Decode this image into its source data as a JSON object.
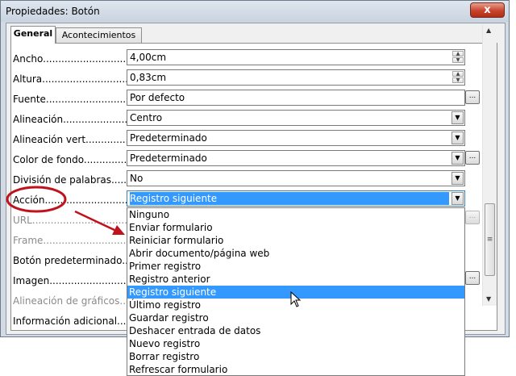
{
  "window": {
    "title": "Propiedades: Botón",
    "close": "x"
  },
  "tabs": [
    {
      "label": "General"
    },
    {
      "label": "Acontecimientos"
    }
  ],
  "fields": {
    "ancho": {
      "label": "Ancho.....................................",
      "value": "4,00cm"
    },
    "altura": {
      "label": "Altura.....................................",
      "value": "0,83cm"
    },
    "fuente": {
      "label": "Fuente....................................",
      "value": "Por defecto"
    },
    "alineacion": {
      "label": "Alineación................................",
      "value": "Centro"
    },
    "alineacion_vert": {
      "label": "Alineación vert.........................",
      "value": "Predeterminado"
    },
    "color_fondo": {
      "label": "Color de fondo..........................",
      "value": "Predeterminado"
    },
    "division": {
      "label": "División de palabras...............",
      "value": "No"
    },
    "accion": {
      "label": "Acción.....................................",
      "value": "Registro siguiente"
    },
    "url": {
      "label": "URL..........................................."
    },
    "frame": {
      "label": "Frame........................................"
    },
    "boton_pred": {
      "label": "Botón predeterminado................"
    },
    "imagen": {
      "label": "Imagen......................................"
    },
    "alin_graficos": {
      "label": "Alineación de gráficos..............."
    },
    "info_adicional": {
      "label": "Información adicional................"
    }
  },
  "buttons": {
    "dots": "..."
  },
  "dropdown_options": [
    "Ninguno",
    "Enviar formulario",
    "Reiniciar formulario",
    "Abrir documento/página web",
    "Primer registro",
    "Registro anterior",
    "Registro siguiente",
    "Último registro",
    "Guardar registro",
    "Deshacer entrada de datos",
    "Nuevo registro",
    "Borrar registro",
    "Refrescar formulario"
  ],
  "dropdown_selected": "Registro siguiente",
  "icons": {
    "spin_up": "▲",
    "spin_down": "▼",
    "dropdown": "▼",
    "scroll_up": "▲",
    "scroll_down": "▼",
    "grip": "≡"
  },
  "colors": {
    "highlight": "#3399ff",
    "annotation": "#c0121c"
  }
}
